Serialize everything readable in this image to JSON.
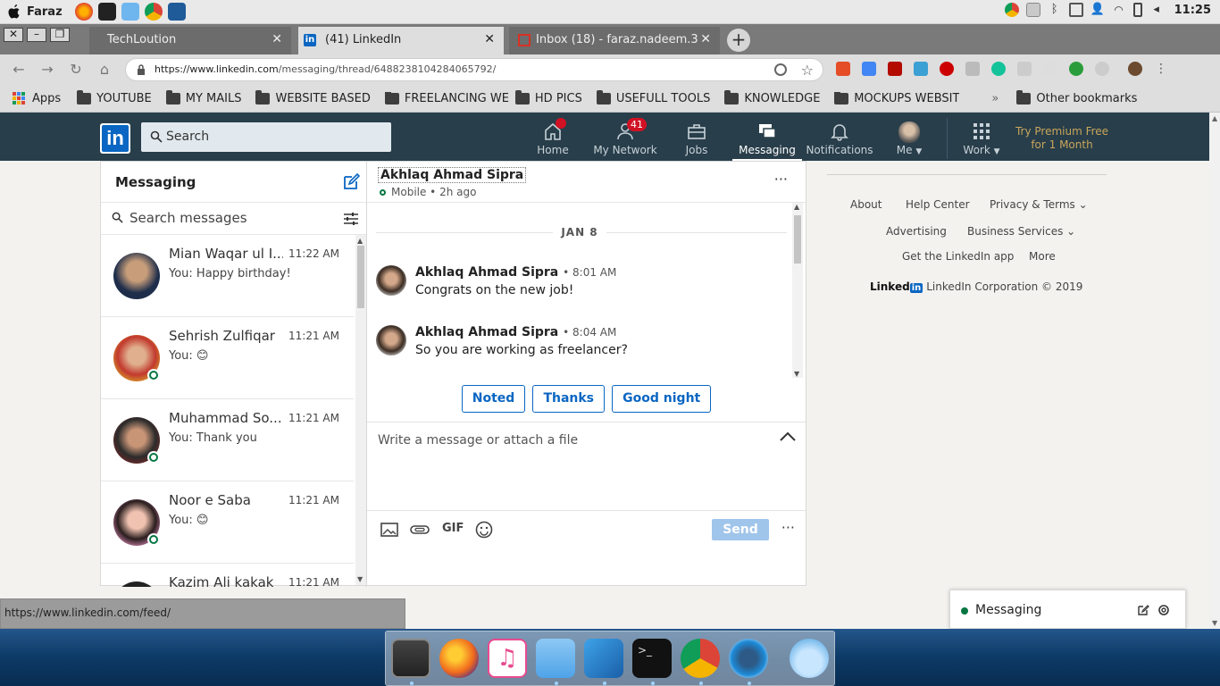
{
  "os": {
    "user": "Faraz",
    "clock": "11:25"
  },
  "browser": {
    "tabs": [
      {
        "title": "TechLoution"
      },
      {
        "title": "(41) LinkedIn"
      },
      {
        "title": "Inbox (18) - faraz.nadeem.3"
      }
    ],
    "url_host": "https://www.linkedin.com",
    "url_path": "/messaging/thread/6488238104284065792/",
    "bookmarks": [
      "Apps",
      "YOUTUBE",
      "MY MAILS",
      "WEBSITE BASED",
      "FREELANCING WE",
      "HD PICS",
      "USEFULL TOOLS",
      "KNOWLEDGE",
      "MOCKUPS WEBSIT"
    ],
    "other_bookmarks": "Other bookmarks",
    "status_url": "https://www.linkedin.com/feed/"
  },
  "linkedin": {
    "search_placeholder": "Search",
    "nav": {
      "home": "Home",
      "network": "My Network",
      "network_badge": "41",
      "jobs": "Jobs",
      "messaging": "Messaging",
      "notifications": "Notifications",
      "me": "Me",
      "work": "Work"
    },
    "premium": "Try Premium Free for 1 Month"
  },
  "messaging": {
    "title": "Messaging",
    "search_placeholder": "Search messages",
    "conversations": [
      {
        "name": "Mian Waqar ul I...",
        "time": "11:22 AM",
        "preview": "You: Happy birthday!",
        "online": false
      },
      {
        "name": "Sehrish Zulfiqar",
        "time": "11:21 AM",
        "preview": "You: 😊",
        "online": true
      },
      {
        "name": "Muhammad So...",
        "time": "11:21 AM",
        "preview": "You: Thank you",
        "online": true
      },
      {
        "name": "Noor e Saba",
        "time": "11:21 AM",
        "preview": "You: 😊",
        "online": true
      },
      {
        "name": "Kazim Ali kakak",
        "time": "11:21 AM",
        "preview": "",
        "online": false
      }
    ],
    "thread": {
      "name": "Akhlaq Ahmad Sipra",
      "status": "Mobile • 2h ago",
      "date": "JAN 8",
      "messages": [
        {
          "sender": "Akhlaq Ahmad Sipra",
          "time": "• 8:01 AM",
          "text": "Congrats on the new job!"
        },
        {
          "sender": "Akhlaq Ahmad Sipra",
          "time": "• 8:04 AM",
          "text": "So you are working as freelancer?"
        }
      ],
      "quick_replies": [
        "Noted",
        "Thanks",
        "Good night"
      ],
      "composer_placeholder": "Write a message or attach a file",
      "gif_label": "GIF",
      "send_label": "Send"
    }
  },
  "footer": {
    "about": "About",
    "help": "Help Center",
    "privacy": "Privacy & Terms",
    "advertising": "Advertising",
    "business": "Business Services",
    "app": "Get the LinkedIn app",
    "more": "More",
    "brand": "Linked",
    "brand_in": "in",
    "copyright": "LinkedIn Corporation © 2019"
  },
  "overlay": {
    "label": "Messaging"
  },
  "colors": {
    "linkedin_nav": "#283e4a",
    "linkedin_blue": "#0a66c2",
    "online_green": "#057642",
    "badge_red": "#d11124"
  }
}
